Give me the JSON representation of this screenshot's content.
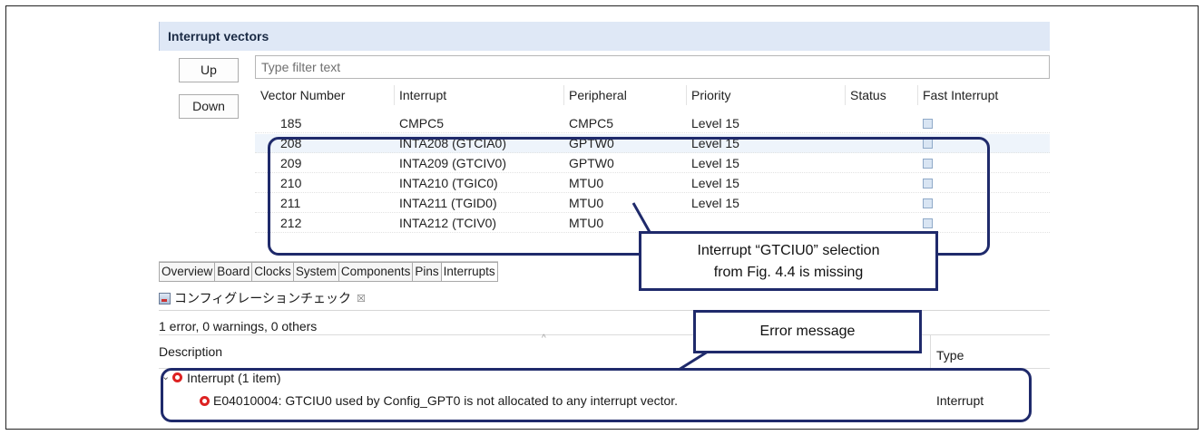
{
  "interrupt_vectors": {
    "title": "Interrupt vectors",
    "up_label": "Up",
    "down_label": "Down",
    "filter_placeholder": "Type filter text",
    "columns": [
      "Vector Number",
      "Interrupt",
      "Peripheral",
      "Priority",
      "Status",
      "Fast Interrupt"
    ],
    "rows": [
      {
        "vector": "185",
        "interrupt": "CMPC5",
        "peripheral": "CMPC5",
        "priority": "Level 15",
        "status": "",
        "fast": false
      },
      {
        "vector": "208",
        "interrupt": "INTA208 (GTCIA0)",
        "peripheral": "GPTW0",
        "priority": "Level 15",
        "status": "",
        "fast": false,
        "selected": true
      },
      {
        "vector": "209",
        "interrupt": "INTA209 (GTCIV0)",
        "peripheral": "GPTW0",
        "priority": "Level 15",
        "status": "",
        "fast": false
      },
      {
        "vector": "210",
        "interrupt": "INTA210 (TGIC0)",
        "peripheral": "MTU0",
        "priority": "Level 15",
        "status": "",
        "fast": false
      },
      {
        "vector": "211",
        "interrupt": "INTA211 (TGID0)",
        "peripheral": "MTU0",
        "priority": "Level 15",
        "status": "",
        "fast": false
      },
      {
        "vector": "212",
        "interrupt": "INTA212 (TCIV0)",
        "peripheral": "MTU0",
        "priority": "",
        "status": "",
        "fast": false
      }
    ]
  },
  "tabs": [
    "Overview",
    "Board",
    "Clocks",
    "System",
    "Components",
    "Pins",
    "Interrupts"
  ],
  "active_tab": "Interrupts",
  "config_check": {
    "title": "コンフィグレーションチェック",
    "close_glyph": "☒",
    "summary": "1 error, 0 warnings, 0 others",
    "description_header": "Description",
    "type_header": "Type",
    "group_label": "Interrupt (1 item)",
    "error_message": "E04010004: GTCIU0 used by Config_GPT0 is not allocated to any interrupt vector.",
    "error_type": "Interrupt"
  },
  "annotations": {
    "missing_line1": "Interrupt “GTCIU0” selection",
    "missing_line2": "from Fig. 4.4 is missing",
    "error_label": "Error message"
  },
  "colors": {
    "annotation": "#1f2a6b",
    "header_bg": "#dfe8f6",
    "error_red": "#d22222"
  },
  "icons": {
    "error": "error-icon",
    "tree_expand": "tree-expand-icon",
    "panel": "config-check-icon",
    "checkbox": "checkbox-icon"
  }
}
